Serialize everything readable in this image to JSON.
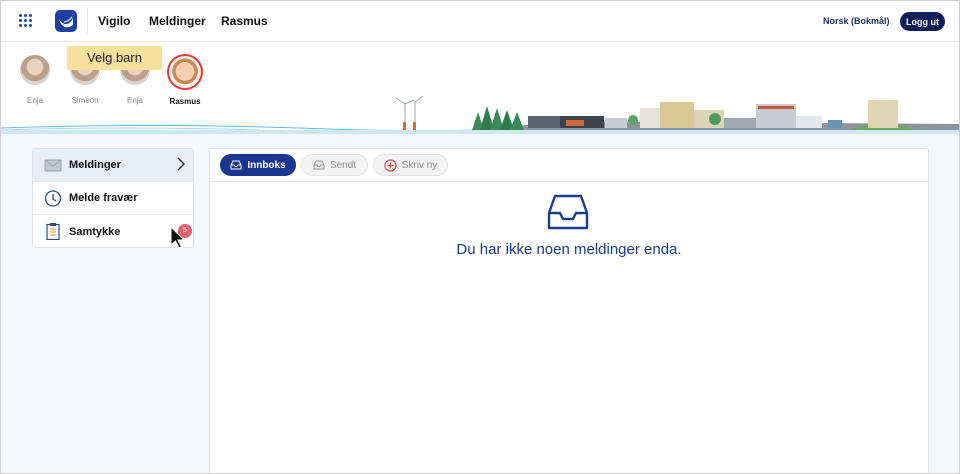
{
  "header": {
    "nav": [
      "Vigilo",
      "Meldinger",
      "Rasmus"
    ],
    "language": "Norsk (Bokmål)",
    "logout_label": "Logg ut"
  },
  "children": {
    "tooltip": "Velg barn",
    "items": [
      {
        "name": "Enja"
      },
      {
        "name": "Simeon"
      },
      {
        "name": "Enja"
      },
      {
        "name": "Rasmus",
        "selected": true
      }
    ]
  },
  "sidebar": {
    "items": [
      {
        "label": "Meldinger",
        "icon": "envelope-icon",
        "active": true
      },
      {
        "label": "Melde fravær",
        "icon": "clock-icon"
      },
      {
        "label": "Samtykke",
        "icon": "clipboard-icon",
        "badge": "5"
      }
    ]
  },
  "main": {
    "tabs": [
      {
        "label": "Innboks",
        "icon": "inbox-icon",
        "active": true
      },
      {
        "label": "Sendt",
        "icon": "sent-icon"
      },
      {
        "label": "Skriv ny",
        "icon": "plus-circle-icon"
      }
    ],
    "empty_message": "Du har ikke noen meldinger enda."
  },
  "colors": {
    "brand": "#1f3ea3",
    "primary_dark": "#0f1f5a",
    "active_tab": "#1a3690",
    "badge": "#e4606b",
    "tooltip": "#f7df9c",
    "selected_ring": "#e53b3b"
  }
}
